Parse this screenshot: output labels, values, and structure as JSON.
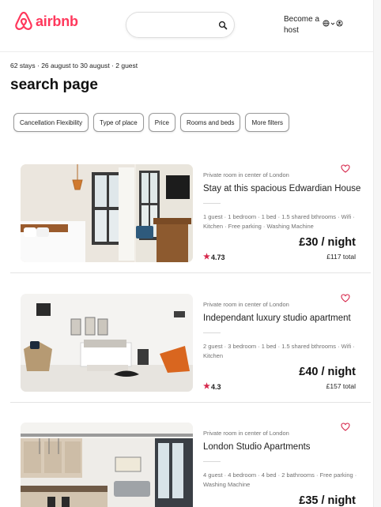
{
  "brand": {
    "name": "airbnb",
    "color": "#FF385C"
  },
  "header": {
    "search_placeholder": "",
    "host_label": "Become a host",
    "icons": [
      "globe-icon",
      "chevron-down-icon",
      "user-circle-icon"
    ]
  },
  "summary": "62 stays · 26 august to 30 august · 2 guest",
  "title": "search page",
  "filters": [
    "Cancellation Flexibility",
    "Type of place",
    "Price",
    "Rooms and beds",
    "More filters"
  ],
  "listings": [
    {
      "type": "Private room in center of London",
      "title": "Stay at this spacious Edwardian House",
      "amenities": "1 guest · 1 bedroom · 1 bed · 1.5 shared bthrooms · Wifi · Kitchen · Free parking · Washing Machine",
      "price": "£30 / night",
      "total": "£117 total",
      "rating": "4.73"
    },
    {
      "type": "Private room in center of London",
      "title": "Independant luxury studio apartment",
      "amenities": "2 guest · 3 bedroom · 1 bed · 1.5 shared bthrooms · Wifi · Kitchen",
      "price": "£40 / night",
      "total": "£157 total",
      "rating": "4.3"
    },
    {
      "type": "Private room in center of London",
      "title": "London Studio Apartments",
      "amenities": "4 guest · 4 bedroom · 4 bed · 2 bathrooms · Free parking · Washing Machine",
      "price": "£35 / night",
      "total": "",
      "rating": ""
    }
  ]
}
